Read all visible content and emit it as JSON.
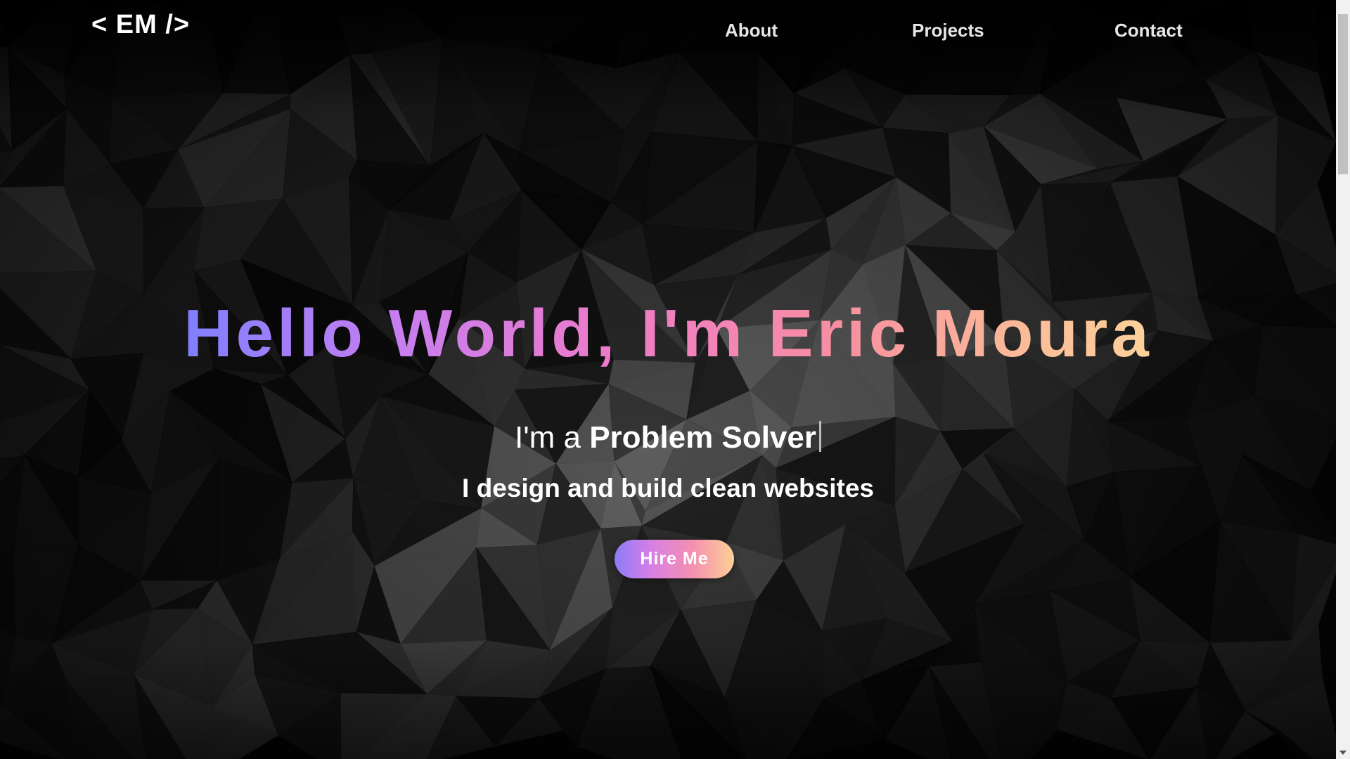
{
  "nav": {
    "logo": "< EM />",
    "links": [
      {
        "label": "About"
      },
      {
        "label": "Projects"
      },
      {
        "label": "Contact"
      }
    ]
  },
  "hero": {
    "title": "Hello World, I'm Eric Moura",
    "tagline_prefix": "I'm a ",
    "tagline_role": "Problem Solver",
    "subtitle": "I design and build clean websites",
    "cta_label": "Hire Me"
  },
  "colors": {
    "background": "#050505",
    "gradient_start": "#7f7fff",
    "gradient_mid": "#ef7bc8",
    "gradient_end": "#fcd39a",
    "text": "#ffffff"
  },
  "icons": {
    "scroll_down": "chevron-down-icon"
  }
}
